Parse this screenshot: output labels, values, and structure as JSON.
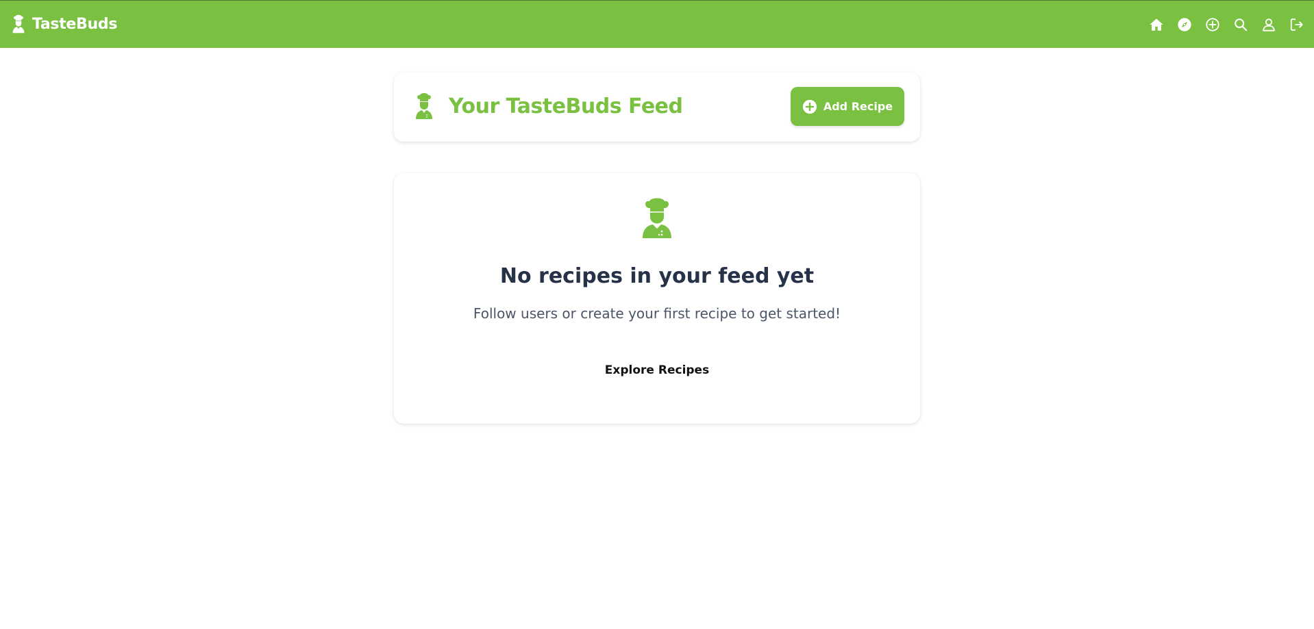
{
  "app": {
    "brand_name": "TasteBuds",
    "brand_icon": "chef-icon",
    "accent_color": "#7ac142"
  },
  "nav": {
    "icons": [
      "home-icon",
      "compass-icon",
      "add-circle-icon",
      "search-icon",
      "user-icon",
      "logout-icon"
    ]
  },
  "feed_header": {
    "title": "Your TasteBuds Feed",
    "icon": "chef-icon",
    "add_button_label": "Add Recipe",
    "add_button_icon": "plus-circle-icon"
  },
  "empty_state": {
    "icon": "chef-icon",
    "title": "No recipes in your feed yet",
    "subtitle": "Follow users or create your first recipe to get started!",
    "explore_label": "Explore Recipes"
  }
}
